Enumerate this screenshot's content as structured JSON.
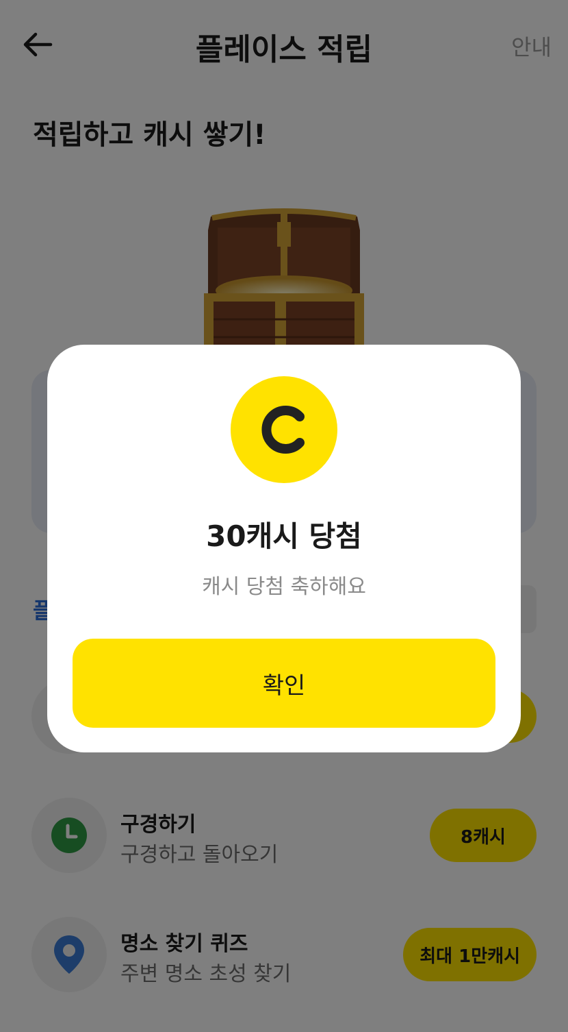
{
  "header": {
    "back_icon": "arrow-left-icon",
    "title": "플레이스 적립",
    "info_link": "안내"
  },
  "hero": {
    "headline": "적립하고 캐시 쌓기!",
    "image_icon": "treasure-chest-icon"
  },
  "section": {
    "label": "플"
  },
  "tasks": [
    {
      "title": "구경하기",
      "subtitle": "구경하고 돌아오기",
      "reward": "8캐시",
      "icon": "clock-icon",
      "icon_color": "#2e9b45"
    },
    {
      "title": "명소 찾기 퀴즈",
      "subtitle": "주변 명소 초성 찾기",
      "reward": "최대 1만캐시",
      "icon": "map-pin-icon",
      "icon_color": "#3a7bd5"
    }
  ],
  "modal": {
    "coin_letter": "C",
    "coin_color": "#ffe200",
    "title": "30캐시 당첨",
    "subtitle": "캐시 당첨 축하해요",
    "confirm_label": "확인"
  },
  "colors": {
    "accent_yellow": "#ffe200",
    "overlay": "rgba(0,0,0,0.5)"
  }
}
